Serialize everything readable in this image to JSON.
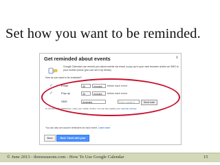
{
  "slide": {
    "title": "Set how you want to be reminded.",
    "footer": "© June 2013 - threeseasons.com - How To Use Google Calendar",
    "page_number": "15"
  },
  "dialog": {
    "title": "Get reminded about events",
    "close_glyph": "x",
    "intro_text": "Google Calendar can remind you about events via email, a pop-up in your web browser and/or an SMS to your mobile phone (you can set it up below).",
    "how_label": "How do you want to be reminded?",
    "icon": "phone-icon",
    "check_glyph": "✓",
    "reminders": [
      {
        "method": "Email",
        "amount": "30",
        "unit": "minutes",
        "suffix": "before each event"
      },
      {
        "method": "Pop-up",
        "amount": "30",
        "unit": "minutes",
        "suffix": "before each event"
      }
    ],
    "sms": {
      "method": "SMS",
      "country": "Australia",
      "phone_placeholder": "Enter mobile #",
      "send_label": "Send code"
    },
    "sms_note": "To receive SMS notifications, verify your mobile number. You can also update your",
    "sms_note_link": "calendar settings",
    "custom_note": "You can also set custom reminders for each event.",
    "custom_link": "Learn more",
    "back_label": "Back",
    "next_label": "Next: Tweet with your mobile"
  },
  "colors": {
    "highlight_oval": "#c8102e",
    "footer_band": "#d3d8b8",
    "primary_button": "#4d90fe",
    "link": "#1155cc"
  }
}
